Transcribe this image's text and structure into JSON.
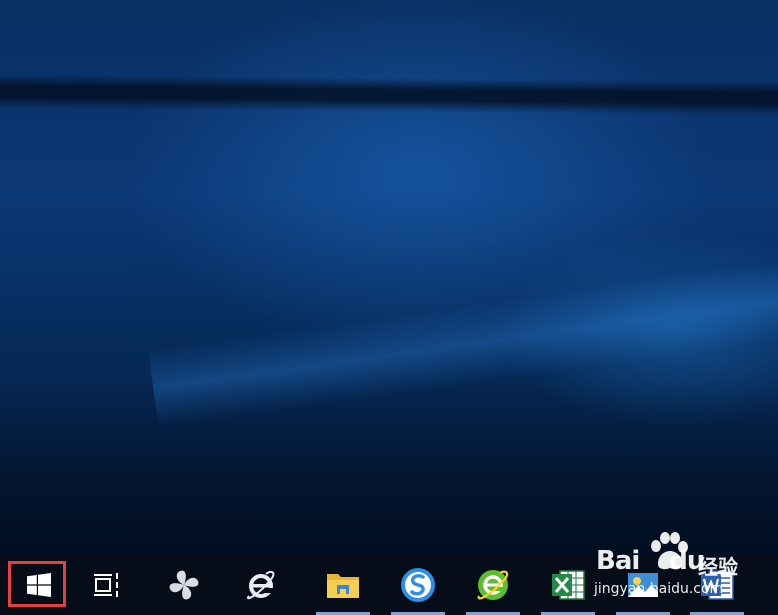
{
  "desktop": {
    "name": "Windows 10 desktop"
  },
  "taskbar": {
    "items": [
      {
        "key": "start",
        "icon": "windows-logo-icon"
      },
      {
        "key": "task-view",
        "icon": "task-view-icon"
      },
      {
        "key": "pinwheel-app",
        "icon": "pinwheel-icon"
      },
      {
        "key": "internet-explorer",
        "icon": "internet-explorer-icon"
      },
      {
        "key": "file-explorer",
        "icon": "folder-icon"
      },
      {
        "key": "sogou-browser",
        "icon": "sogou-icon"
      },
      {
        "key": "360-browser",
        "icon": "green-e-browser-icon"
      },
      {
        "key": "excel",
        "icon": "excel-icon"
      },
      {
        "key": "photo-app",
        "icon": "photo-icon"
      },
      {
        "key": "word",
        "icon": "word-icon"
      }
    ]
  },
  "watermark": {
    "brand": "Bai",
    "brand_suffix": "du",
    "subtitle": "经验",
    "url": "jingyan.baidu.com"
  },
  "colors": {
    "taskbar": "#060d18",
    "selection": "#e3413f",
    "running_indicator": "#7ea3d6"
  }
}
